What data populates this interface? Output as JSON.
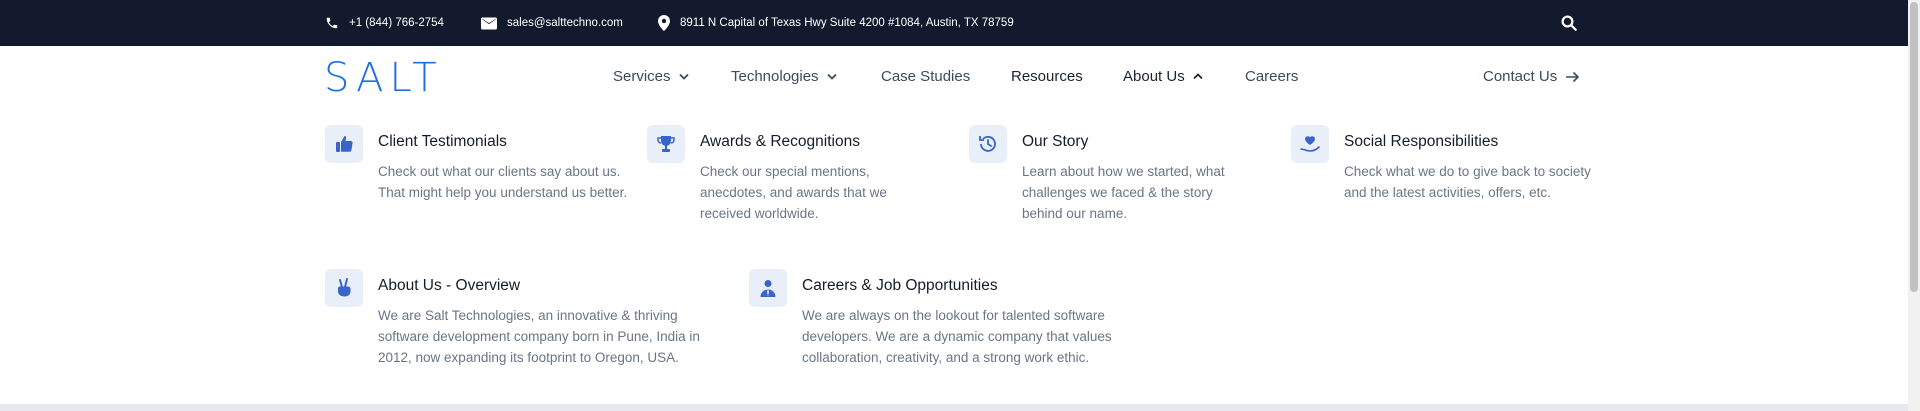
{
  "topbar": {
    "phone": "+1 (844) 766-2754",
    "email": "sales@salttechno.com",
    "address": "8911 N Capital of Texas Hwy Suite 4200 #1084, Austin, TX 78759",
    "icons": [
      "phone-icon",
      "mail-icon",
      "location-pin-icon",
      "search-icon"
    ]
  },
  "nav": {
    "logo": "SALT",
    "items": [
      {
        "label": "Services",
        "has_dropdown": true
      },
      {
        "label": "Technologies",
        "has_dropdown": true
      },
      {
        "label": "Case Studies"
      },
      {
        "label": "Resources"
      },
      {
        "label": "About Us",
        "has_dropdown": true,
        "open": true
      },
      {
        "label": "Careers"
      }
    ],
    "contact": "Contact Us"
  },
  "menu": [
    {
      "title": "Client Testimonials",
      "desc": "Check out what our clients say about us. That might help you understand us better.",
      "icon": "thumbs-up-icon"
    },
    {
      "title": "Awards & Recognitions",
      "desc": "Check our special mentions, anecdotes, and awards that we received worldwide.",
      "icon": "trophy-icon"
    },
    {
      "title": "Our Story",
      "desc": "Learn about how we started, what challenges we faced & the story behind our name.",
      "icon": "history-icon"
    },
    {
      "title": "Social Responsibilities",
      "desc": "Check what we do to give back to society and the latest activities, offers, etc.",
      "icon": "heart-hand-icon"
    },
    {
      "title": "About Us - Overview",
      "desc": "We are Salt Technologies, an innovative & thriving software development company born in Pune, India in 2012, now expanding its footprint to Oregon, USA.",
      "icon": "victory-hand-icon"
    },
    {
      "title": "Careers & Job Opportunities",
      "desc": "We are always on the lookout for talented software developers. We are a dynamic company that values collaboration, creativity, and a strong work ethic.",
      "icon": "professional-icon"
    }
  ],
  "colors": {
    "topbar_bg": "#131a2d",
    "brand": "#1f6fe0",
    "icon_bg": "#e9eff9"
  }
}
